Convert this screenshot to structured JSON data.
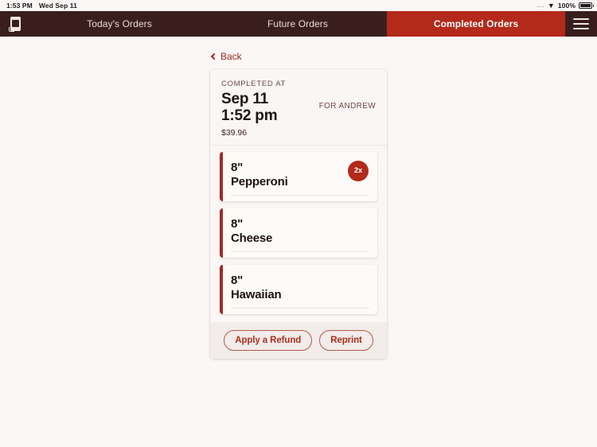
{
  "status_bar": {
    "time": "1:53 PM",
    "date": "Wed Sep 11",
    "signal_dots": "....",
    "wifi_icon": "wifi-icon",
    "battery_percent": "100%",
    "battery_icon": "battery-full-icon"
  },
  "navbar": {
    "logo_icon": "app-logo-icon",
    "tabs": [
      {
        "label": "Today's Orders",
        "active": false
      },
      {
        "label": "Future Orders",
        "active": false
      },
      {
        "label": "Completed Orders",
        "active": true
      }
    ],
    "menu_icon": "hamburger-menu-icon",
    "background": "#3a1e1e",
    "active_tab_color": "#b3291a"
  },
  "back": {
    "label": "Back",
    "icon": "chevron-left-icon"
  },
  "order": {
    "completed_label": "COMPLETED AT",
    "date": "Sep 11",
    "time": "1:52 pm",
    "total": "$39.96",
    "customer": "FOR ANDREW",
    "items": [
      {
        "size": "8\"",
        "name": "Pepperoni",
        "qty_badge": "2x"
      },
      {
        "size": "8\"",
        "name": "Cheese",
        "qty_badge": ""
      },
      {
        "size": "8\"",
        "name": "Hawaiian",
        "qty_badge": ""
      }
    ],
    "actions": {
      "refund_label": "Apply a Refund",
      "reprint_label": "Reprint"
    },
    "accent_color": "#a52a1e",
    "page_background": "#fbf7f6"
  }
}
